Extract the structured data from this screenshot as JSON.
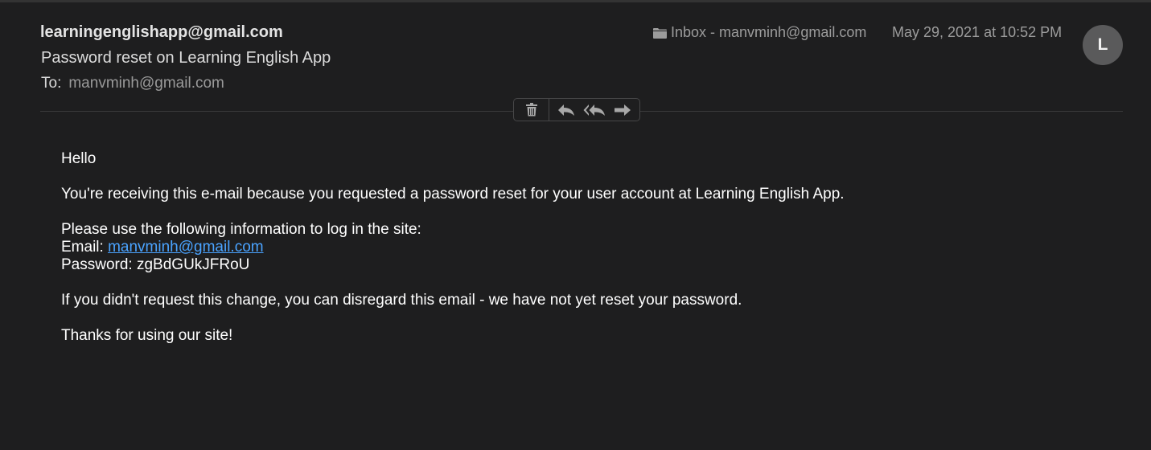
{
  "header": {
    "from": "learningenglishapp@gmail.com",
    "subject": "Password reset on Learning English App",
    "to_label": "To:",
    "to_value": "manvminh@gmail.com",
    "mailbox": "Inbox - manvminh@gmail.com",
    "date": "May 29, 2021 at 10:52 PM",
    "avatar_initial": "L"
  },
  "toolbar": {
    "icons": [
      "trash-icon",
      "reply-icon",
      "reply-all-icon",
      "forward-icon"
    ]
  },
  "body": {
    "greeting": "Hello",
    "line1": "You're receiving this e-mail because you requested a password reset for your user account at Learning English App.",
    "line2": "Please use the following information to log in the site:",
    "email_label": "Email: ",
    "email_value": "manvminh@gmail.com",
    "password_label": "Password: ",
    "password_value": "zgBdGUkJFRoU",
    "line3": "If you didn't request this change, you can disregard this email - we have not yet reset your password.",
    "closing": "Thanks for using our site!"
  },
  "colors": {
    "background": "#1e1e1f",
    "link": "#4aa3ff",
    "avatar": "#5a5a5b"
  }
}
